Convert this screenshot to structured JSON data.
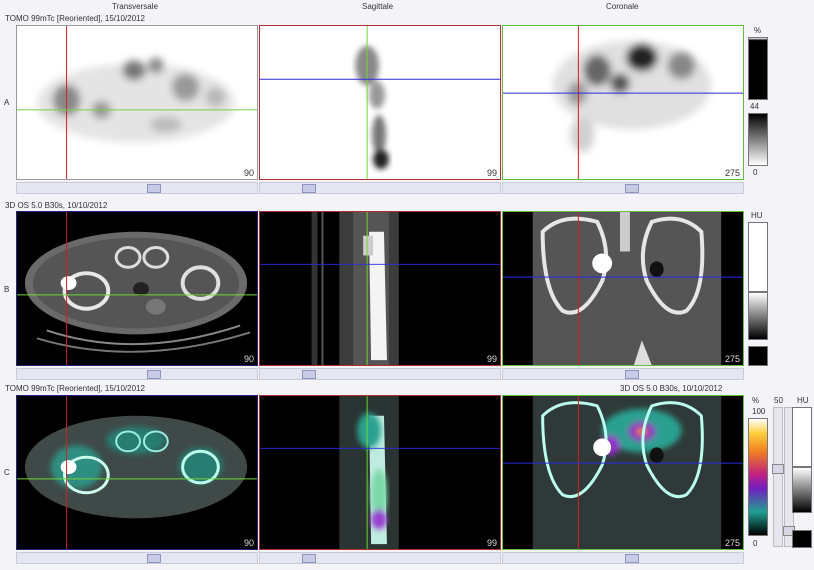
{
  "view_titles": {
    "transversal": "Transversale",
    "sagittal": "Sagittale",
    "coronal": "Coronale"
  },
  "rows": [
    {
      "letter": "A",
      "header_left": "TOMO 99mTc [Reoriented], 15/10/2012",
      "header_right": "",
      "slices": [
        "90",
        "99",
        "275"
      ]
    },
    {
      "letter": "B",
      "header_left": "3D  OS  5.0  B30s, 10/10/2012",
      "header_right": "",
      "slices": [
        "90",
        "99",
        "275"
      ]
    },
    {
      "letter": "C",
      "header_left": "TOMO 99mTc [Reoriented], 15/10/2012",
      "header_right": "3D  OS  5.0  B30s, 10/10/2012",
      "slices": [
        "90",
        "99",
        "275"
      ]
    }
  ],
  "colorbars": {
    "a": {
      "unit": "%",
      "mid_value": "44",
      "min_value": "0"
    },
    "b": {
      "unit": "HU"
    },
    "c": {
      "unit": "%",
      "max_value": "100",
      "min_value": "0",
      "slider_value": "50",
      "ct_unit": "HU"
    }
  },
  "colors": {
    "crosshair_red": "#d22020",
    "crosshair_green": "#6fd63a",
    "crosshair_blue": "#2a2ae0",
    "frame_blue": "#23237a",
    "frame_red": "#b23030",
    "frame_green": "#5fbf45"
  }
}
